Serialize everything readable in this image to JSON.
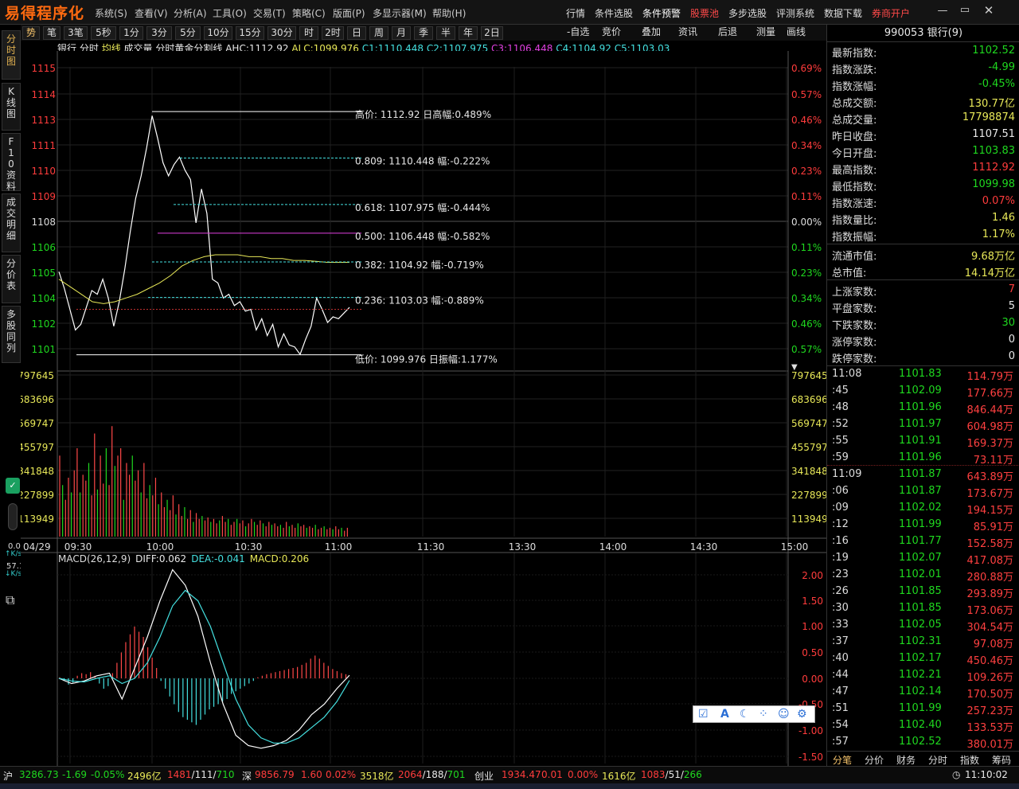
{
  "app": {
    "logo": "易得程序化",
    "menus": [
      "系统(S)",
      "查看(V)",
      "分析(A)",
      "工具(O)",
      "交易(T)",
      "策略(C)",
      "版面(P)",
      "多显示器(M)",
      "帮助(H)"
    ],
    "right_menus": [
      "行情",
      "条件选股",
      "条件预警",
      "股票池",
      "多步选股",
      "评测系统",
      "数据下载",
      "券商开户"
    ]
  },
  "periods": [
    "势",
    "笔",
    "3笔",
    "5秒",
    "1分",
    "3分",
    "5分",
    "10分",
    "15分",
    "30分",
    "时",
    "2时",
    "日",
    "周",
    "月",
    "季",
    "半",
    "年",
    "2日"
  ],
  "tools": [
    "-自选",
    "竞价",
    "叠加",
    "资讯",
    "后退",
    "测量",
    "画线"
  ],
  "side_tabs": [
    "分时图",
    "K线图",
    "F10资料",
    "成交明细",
    "分价表",
    "多股同列"
  ],
  "chart_info": {
    "name": "银行",
    "items": [
      "分时",
      "均线",
      "成交量",
      "分时黄金分割线"
    ],
    "ahc": "AHC:1112.92",
    "alc": "ALC:1099.976",
    "c1": "C1:1110.448",
    "c2": "C2:1107.975",
    "c3": "C3:1106.448",
    "c4": "C4:1104.92",
    "c5": "C5:1103.03",
    "sub": "1"
  },
  "price_axis": [
    "1115",
    "1114",
    "1113",
    "1111",
    "1110",
    "1109",
    "1108",
    "1106",
    "1105",
    "1104",
    "1102",
    "1101"
  ],
  "pct_axis": [
    "0.69%",
    "0.57%",
    "0.46%",
    "0.34%",
    "0.23%",
    "0.11%",
    "0.00%",
    "0.11%",
    "0.23%",
    "0.34%",
    "0.46%",
    "0.57%"
  ],
  "vol_axis": [
    "797645",
    "683696",
    "569747",
    "455797",
    "341848",
    "227899",
    "113949"
  ],
  "time_axis": [
    "04/29",
    "09:30",
    "10:00",
    "10:30",
    "11:00",
    "11:30",
    "13:30",
    "14:00",
    "14:30",
    "15:00"
  ],
  "macd_axis": [
    "2.00",
    "1.50",
    "1.00",
    "0.50",
    "0.00",
    "-0.50",
    "-1.00",
    "-1.50"
  ],
  "macd_info": {
    "title": "MACD(26,12,9)",
    "diff": "DIFF:0.062",
    "dea": "DEA:-0.041",
    "macd": "MACD:0.206"
  },
  "golden_labels": [
    "高价:   1112.92  日高幅:0.489%",
    "0.809:  1110.448  幅:-0.222%",
    "0.618:  1107.975  幅:-0.444%",
    "0.500:  1106.448  幅:-0.582%",
    "0.382:  1104.92  幅:-0.719%",
    "0.236:  1103.03  幅:-0.889%",
    "低价:   1099.976  日振幅:1.177%"
  ],
  "right_panel": {
    "title": "990053 银行(9)",
    "quotes": [
      {
        "label": "最新指数:",
        "value": "1102.52",
        "color": "green"
      },
      {
        "label": "指数涨跌:",
        "value": "-4.99",
        "color": "green"
      },
      {
        "label": "指数涨幅:",
        "value": "-0.45%",
        "color": "green"
      },
      {
        "label": "总成交额:",
        "value": "130.77亿",
        "color": "yellow"
      },
      {
        "label": "总成交量:",
        "value": "17798874",
        "color": "yellow"
      },
      {
        "label": "昨日收盘:",
        "value": "1107.51",
        "color": "white"
      },
      {
        "label": "今日开盘:",
        "value": "1103.83",
        "color": "green"
      },
      {
        "label": "最高指数:",
        "value": "1112.92",
        "color": "red"
      },
      {
        "label": "最低指数:",
        "value": "1099.98",
        "color": "green"
      },
      {
        "label": "指数涨速:",
        "value": "0.07%",
        "color": "red"
      },
      {
        "label": "指数量比:",
        "value": "1.46",
        "color": "yellow"
      },
      {
        "label": "指数振幅:",
        "value": "1.17%",
        "color": "yellow"
      },
      {
        "label": "流通市值:",
        "value": "9.68万亿",
        "color": "yellow"
      },
      {
        "label": "总市值:",
        "value": "14.14万亿",
        "color": "yellow"
      },
      {
        "label": "上涨家数:",
        "value": "7",
        "color": "red"
      },
      {
        "label": "平盘家数:",
        "value": "5",
        "color": "white"
      },
      {
        "label": "下跌家数:",
        "value": "30",
        "color": "green"
      },
      {
        "label": "涨停家数:",
        "value": "0",
        "color": "white"
      },
      {
        "label": "跌停家数:",
        "value": "0",
        "color": "white"
      }
    ],
    "ticks": [
      {
        "t": "11:08",
        "p": "1101.83",
        "v": "114.79万"
      },
      {
        "t": ":45",
        "p": "1102.09",
        "v": "177.66万"
      },
      {
        "t": ":48",
        "p": "1101.96",
        "v": "846.44万"
      },
      {
        "t": ":52",
        "p": "1101.97",
        "v": "604.98万"
      },
      {
        "t": ":55",
        "p": "1101.91",
        "v": "169.37万"
      },
      {
        "t": ":59",
        "p": "1101.96",
        "v": "73.11万"
      },
      {
        "t": "11:09",
        "p": "1101.87",
        "v": "643.89万"
      },
      {
        "t": ":06",
        "p": "1101.87",
        "v": "173.67万"
      },
      {
        "t": ":09",
        "p": "1102.02",
        "v": "194.15万"
      },
      {
        "t": ":12",
        "p": "1101.99",
        "v": "85.91万"
      },
      {
        "t": ":16",
        "p": "1101.77",
        "v": "152.58万"
      },
      {
        "t": ":19",
        "p": "1102.07",
        "v": "417.08万"
      },
      {
        "t": ":23",
        "p": "1102.01",
        "v": "280.88万"
      },
      {
        "t": ":26",
        "p": "1101.85",
        "v": "293.89万"
      },
      {
        "t": ":30",
        "p": "1101.85",
        "v": "173.06万"
      },
      {
        "t": ":33",
        "p": "1102.05",
        "v": "304.54万"
      },
      {
        "t": ":37",
        "p": "1102.31",
        "v": "97.08万"
      },
      {
        "t": ":40",
        "p": "1102.17",
        "v": "450.46万"
      },
      {
        "t": ":44",
        "p": "1102.21",
        "v": "109.26万"
      },
      {
        "t": ":47",
        "p": "1102.14",
        "v": "170.50万"
      },
      {
        "t": ":51",
        "p": "1101.99",
        "v": "257.23万"
      },
      {
        "t": ":54",
        "p": "1102.40",
        "v": "133.53万"
      },
      {
        "t": ":57",
        "p": "1102.52",
        "v": "380.01万"
      }
    ],
    "bottom_tabs": [
      "分笔",
      "分价",
      "财务",
      "分时",
      "指数",
      "筹码"
    ]
  },
  "side_stats": {
    "v1": "0.0",
    "u1": "K/s",
    "v2": "57.1",
    "u2": "K/s"
  },
  "status": {
    "sh": {
      "name": "沪",
      "idx": "3286.73",
      "chg": "-1.69",
      "pct": "-0.05%",
      "amt": "2496亿",
      "ud": "1481/111/710"
    },
    "sz": {
      "name": "深",
      "idx": "9856.79",
      "chg": "1.60",
      "pct": "0.02%",
      "amt": "3518亿",
      "ud": "2064/188/701"
    },
    "cy": {
      "name": "创业",
      "idx": "1934.47",
      "chg": "0.01",
      "pct": "0.00%",
      "amt": "1616亿",
      "ud": "1083/51/266"
    },
    "time": "11:10:02"
  },
  "chart_data": {
    "type": "line",
    "x": [
      "09:30",
      "09:40",
      "09:50",
      "10:00",
      "10:10",
      "10:20",
      "10:30",
      "10:40",
      "10:50",
      "11:00",
      "11:08"
    ],
    "series": [
      {
        "values": [
          1104.5,
          1101.2,
          1102.0,
          1112.9,
          1110.2,
          1104.6,
          1102.2,
          1101.1,
          1100.3,
          1103.0,
          1102.5
        ]
      },
      {
        "values": [
          1104.0,
          1102.8,
          1102.3,
          1104.0,
          1105.3,
          1105.3,
          1105.1,
          1105.0,
          1104.9,
          1104.9,
          1104.9
        ]
      }
    ],
    "ylim": [
      1099.98,
      1112.92
    ],
    "grid": true
  },
  "colors": {
    "bg": "#000000",
    "grid": "#2a2a2a",
    "up": "#ff3c3c",
    "down": "#1fd81f",
    "price": "#ffffff",
    "avg": "#e8e858"
  }
}
